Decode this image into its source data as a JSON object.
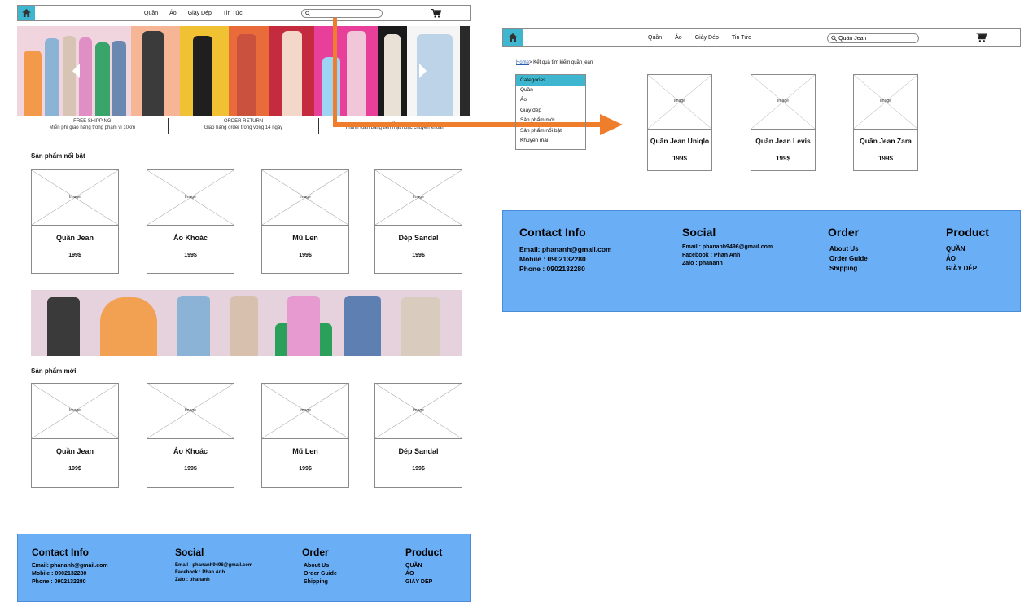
{
  "left_page": {
    "nav": {
      "links": [
        "Quần",
        "Áo",
        "Giày Dép",
        "Tin Tức"
      ],
      "search_placeholder": ""
    },
    "features": [
      {
        "title": "FREE SHIPPING",
        "desc": "Miễn phí giao hàng trong phạm vi 10km"
      },
      {
        "title": "ORDER RETURN",
        "desc": "Giao hàng order trong vòng 14 ngày"
      },
      {
        "title": "...",
        "desc": "Thanh toán bằng tiền mặt hoặc chuyển khoản"
      }
    ],
    "featured_title": "Sản phẩm nổi bật",
    "featured_products": [
      {
        "image_label": "Image",
        "name": "Quần Jean",
        "price": "199$"
      },
      {
        "image_label": "Image",
        "name": "Áo Khoác",
        "price": "199$"
      },
      {
        "image_label": "Image",
        "name": "Mũ Len",
        "price": "199$"
      },
      {
        "image_label": "Image",
        "name": "Dép Sandal",
        "price": "199$"
      }
    ],
    "new_title": "Sản phẩm mới",
    "new_products": [
      {
        "image_label": "Image",
        "name": "Quần Jean",
        "price": "199$"
      },
      {
        "image_label": "Image",
        "name": "Áo Khoác",
        "price": "199$"
      },
      {
        "image_label": "Image",
        "name": "Mũ Len",
        "price": "199$"
      },
      {
        "image_label": "Image",
        "name": "Dép Sandal",
        "price": "199$"
      }
    ]
  },
  "right_page": {
    "nav": {
      "links": [
        "Quần",
        "Áo",
        "Giày Dép",
        "Tin Tức"
      ],
      "search_value": "Quần Jean"
    },
    "breadcrumb": {
      "home": "Home",
      "rest": "> Kết quả tìm kiếm quần jean"
    },
    "categories": {
      "title": "Categories",
      "items": [
        "Quần",
        "Áo",
        "Giày dép",
        "Sản phẩm mới",
        "Sản phẩm nổi bật",
        "Khuyến mãi"
      ]
    },
    "results": [
      {
        "image_label": "Image",
        "name": "Quần Jean Uniqlo",
        "price": "199$"
      },
      {
        "image_label": "Image",
        "name": "Quần Jean Levis",
        "price": "199$"
      },
      {
        "image_label": "Image",
        "name": "Quần Jean Zara",
        "price": "199$"
      }
    ]
  },
  "footer": {
    "contact": {
      "title": "Contact Info",
      "lines": [
        "Email: phananh@gmail.com",
        "Mobile : 0902132280",
        "Phone : 0902132280"
      ]
    },
    "social": {
      "title": "Social",
      "lines": [
        "Email : phananh9496@gmail.com",
        "Facebook : Phan Anh",
        "Zalo : phananh"
      ]
    },
    "order": {
      "title": "Order",
      "lines": [
        "About Us",
        "Order Guide",
        "Shipping"
      ]
    },
    "product": {
      "title": "Product",
      "lines": [
        "QUẦN",
        "ÁO",
        "GIÀY DÉP"
      ]
    }
  },
  "icons": {
    "home": "home-icon",
    "search": "search-icon",
    "cart": "cart-icon",
    "flow_arrow": "arrow-right-icon"
  },
  "colors": {
    "accent": "#3fb6cf",
    "footer": "#6aaef5",
    "arrow": "#ef7d2b"
  }
}
